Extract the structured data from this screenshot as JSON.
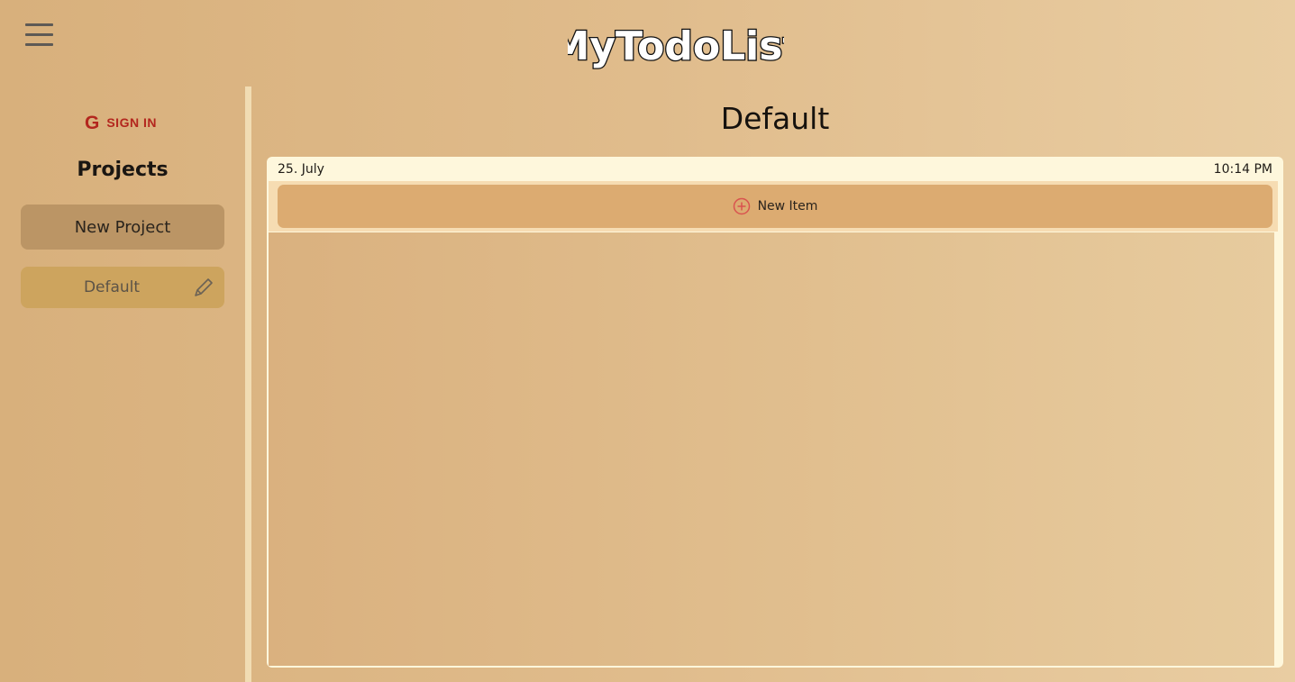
{
  "header": {
    "app_title": "MyTodoList",
    "menu_icon": "hamburger-icon"
  },
  "sidebar": {
    "sign_in_icon": "google-icon",
    "sign_in_glyph": "G",
    "sign_in_label": "SIGN IN",
    "projects_heading": "Projects",
    "new_project_label": "New Project",
    "projects": [
      {
        "label": "Default",
        "icon": "pencil-icon"
      }
    ]
  },
  "main": {
    "title": "Default",
    "date": "25. July",
    "time": "10:14 PM",
    "new_item_label": "New Item",
    "new_item_icon": "plus-circle-icon"
  },
  "colors": {
    "accent_red": "#b3261e",
    "new_item_icon": "#d9534f",
    "panel": "#fef7dc"
  }
}
